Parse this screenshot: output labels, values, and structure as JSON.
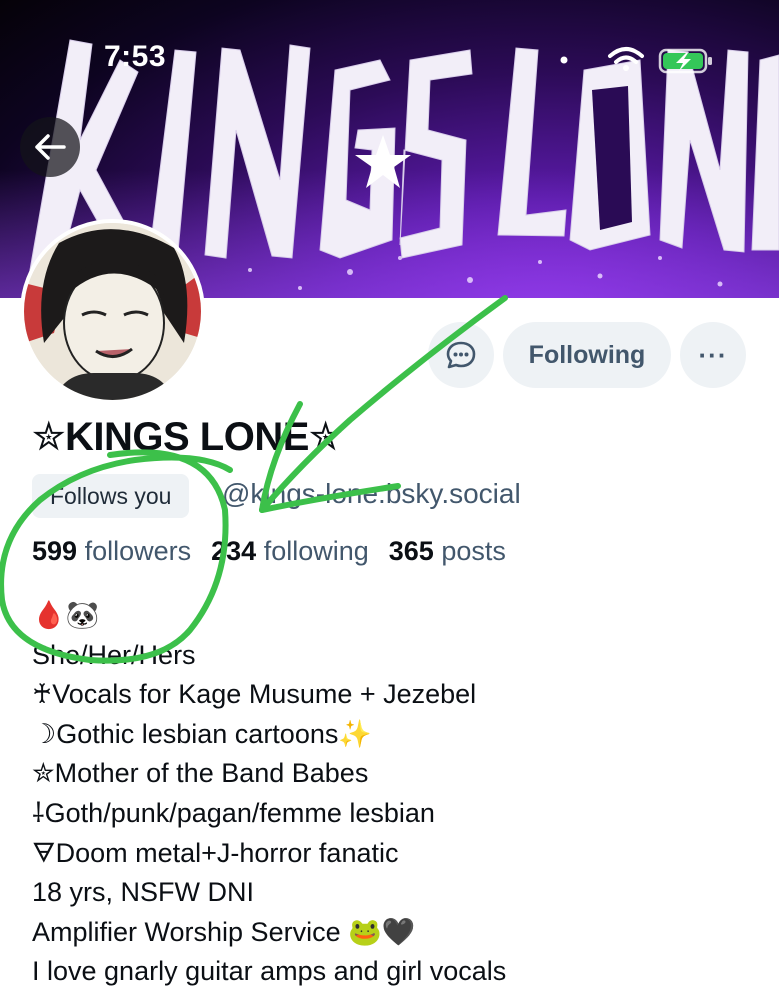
{
  "status_bar": {
    "time": "7:53"
  },
  "banner": {
    "text": "KINGS★LONE"
  },
  "profile": {
    "display_name": "✮KINGS LONE✮",
    "follows_you": "Follows you",
    "handle": "@kings-lone.bsky.social",
    "following_button": "Following",
    "more_button": "···"
  },
  "stats": {
    "followers_count": "599",
    "followers_label": "followers",
    "following_count": "234",
    "following_label": "following",
    "posts_count": "365",
    "posts_label": "posts"
  },
  "bio": [
    "🩸🐼",
    "She/Her/Hers",
    "♰Vocals for Kage Musume + Jezebel",
    "☽Gothic lesbian cartoons✨",
    "✮Mother of the Band Babes",
    "⸸Goth/punk/pagan/femme lesbian",
    "🜃Doom metal+J-horror fanatic",
    "18 yrs, NSFW DNI",
    "Amplifier Worship Service 🐸🖤",
    "I love gnarly guitar amps and girl vocals"
  ],
  "colors": {
    "muted_text": "#42576c",
    "button_bg": "#eef2f5",
    "annotation_green": "#3cc04a",
    "banner_purple": "#6a1fc4"
  },
  "icons": [
    "back-arrow-icon",
    "chat-bubble-icon",
    "wifi-icon",
    "battery-charging-icon",
    "signal-icon"
  ]
}
